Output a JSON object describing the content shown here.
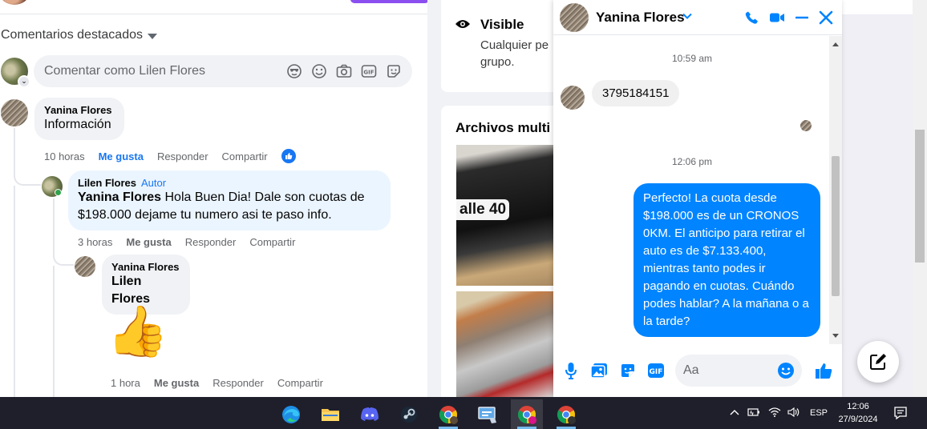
{
  "comments": {
    "featured_label": "Comentarios destacados",
    "composer_placeholder": "Comentar como Lilen Flores",
    "items": [
      {
        "author": "Yanina Flores",
        "text": "Información",
        "time": "10 horas",
        "like": "Me gusta",
        "reply": "Responder",
        "share": "Compartir"
      },
      {
        "author": "Lilen Flores",
        "author_badge": "Autor",
        "mention": "Yanina Flores",
        "text": " Hola Buen Dia! Dale son cuotas de $198.000 dejame tu numero asi te paso info.",
        "time": "3 horas",
        "like": "Me gusta",
        "reply": "Responder",
        "share": "Compartir"
      },
      {
        "author": "Yanina Flores",
        "mention": "Lilen Flores",
        "sticker": "👍",
        "time": "1 hora",
        "like": "Me gusta",
        "reply": "Responder",
        "share": "Compartir"
      }
    ]
  },
  "group_info": {
    "visible_title": "Visible",
    "visible_desc": "Cualquier pe grupo.",
    "media_title": "Archivos multi",
    "photo_label": "alle 40"
  },
  "chat": {
    "contact_name": "Yanina Flores",
    "messages": [
      {
        "type": "timestamp",
        "text": "10:59 am"
      },
      {
        "type": "incoming",
        "text": "3795184151"
      },
      {
        "type": "timestamp",
        "text": "12:06 pm"
      },
      {
        "type": "outgoing",
        "text": "Perfecto! La cuota desde $198.000 es de un CRONOS 0KM. El anticipo para retirar el auto es de $7.133.400, mientras tanto podes ir pagando en cuotas. Cuándo podes hablar? A la mañana o a la tarde?"
      }
    ],
    "input_placeholder": "Aa",
    "accent": "#0084ff"
  },
  "taskbar": {
    "apps": [
      "edge",
      "file-explorer",
      "discord",
      "steam",
      "chrome",
      "control-panel",
      "chrome-profile",
      "chrome-profile-2"
    ],
    "language": "ESP",
    "time": "12:06",
    "date": "27/9/2024"
  }
}
